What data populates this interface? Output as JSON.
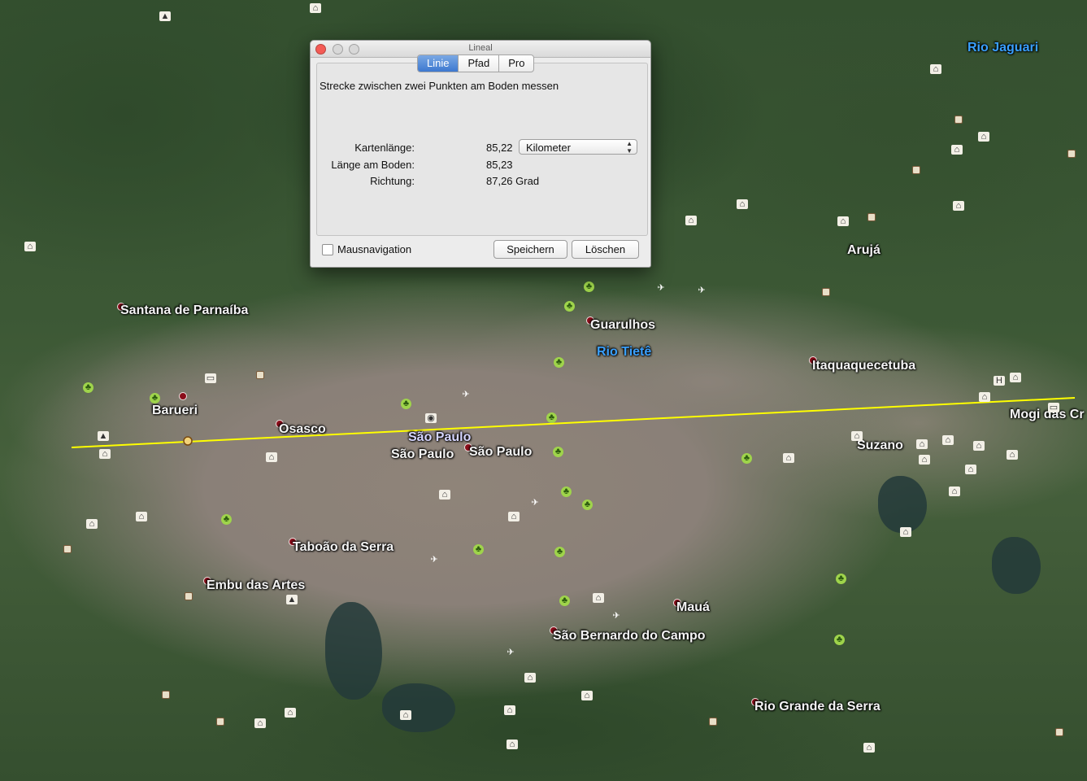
{
  "window": {
    "title": "Lineal",
    "tabs": [
      {
        "label": "Linie",
        "active": true
      },
      {
        "label": "Pfad",
        "active": false
      },
      {
        "label": "Pro",
        "active": false
      }
    ],
    "description": "Strecke zwischen zwei Punkten am Boden messen",
    "measurements": {
      "map_length_label": "Kartenlänge:",
      "map_length_value": "85,22",
      "unit_selected": "Kilometer",
      "ground_length_label": "Länge am Boden:",
      "ground_length_value": "85,23",
      "heading_label": "Richtung:",
      "heading_value": "87,26 Grad"
    },
    "mouse_navigation_label": "Mausnavigation",
    "mouse_navigation_checked": false,
    "save_label": "Speichern",
    "clear_label": "Löschen"
  },
  "map": {
    "ruler_color": "#ffff00",
    "places": [
      {
        "name": "Rio Jaguari",
        "kind": "river"
      },
      {
        "name": "Arujá",
        "kind": "town"
      },
      {
        "name": "Santana de Parnaíba",
        "kind": "town"
      },
      {
        "name": "Guarulhos",
        "kind": "town"
      },
      {
        "name": "Rio Tietê",
        "kind": "river"
      },
      {
        "name": "Itaquaquecetuba",
        "kind": "town"
      },
      {
        "name": "Barueri",
        "kind": "town"
      },
      {
        "name": "Osasco",
        "kind": "town"
      },
      {
        "name": "São Paulo",
        "kind": "city"
      },
      {
        "name": "São Paulo",
        "kind": "town"
      },
      {
        "name": "São Paulo",
        "kind": "town"
      },
      {
        "name": "Mogi das Cr",
        "kind": "town"
      },
      {
        "name": "Suzano",
        "kind": "town"
      },
      {
        "name": "Taboão da Serra",
        "kind": "town"
      },
      {
        "name": "Embu das Artes",
        "kind": "town"
      },
      {
        "name": "Mauá",
        "kind": "town"
      },
      {
        "name": "São Bernardo do Campo",
        "kind": "town"
      },
      {
        "name": "Rio Grande da Serra",
        "kind": "town"
      }
    ]
  }
}
